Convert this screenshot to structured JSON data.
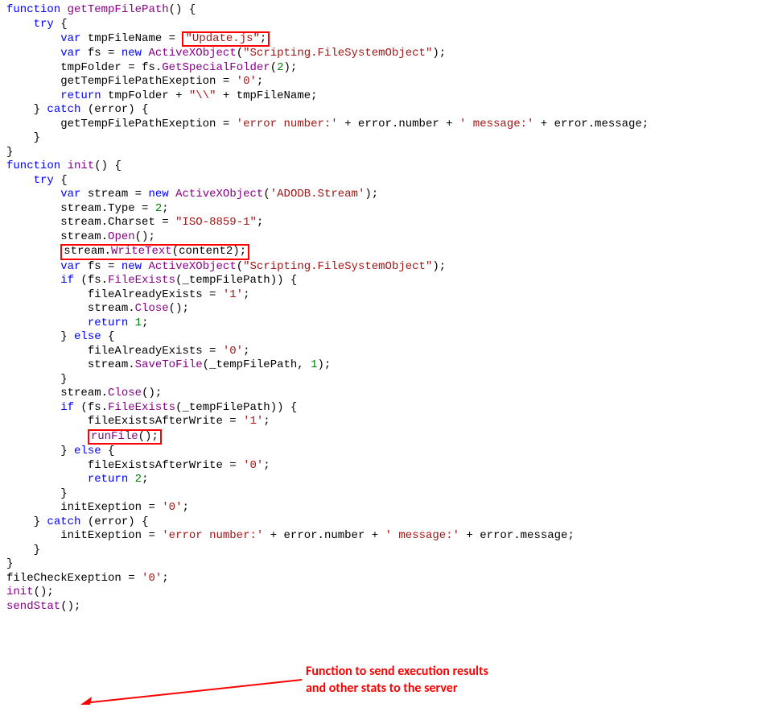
{
  "code": {
    "fn1_decl_function": "function",
    "fn1_name": "getTempFilePath",
    "try_kw": "try",
    "var_kw": "var",
    "new_kw": "new",
    "return_kw": "return",
    "catch_kw": "catch",
    "if_kw": "if",
    "else_kw": "else",
    "tmpFileName_ident": "tmpFileName",
    "update_js_str": "\"Update.js\"",
    "fs_ident": "fs",
    "ActiveXObject": "ActiveXObject",
    "fso_str": "\"Scripting.FileSystemObject\"",
    "tmpFolder_ident": "tmpFolder",
    "GetSpecialFolder": "GetSpecialFolder",
    "two": "2",
    "getTempFilePathExeption_ident": "getTempFilePathExeption",
    "zero_str": "'0'",
    "backslash_str": "\"\\\\\"",
    "error_ident": "error",
    "err_num_str": "'error number:'",
    "number_prop": "number",
    "msg_str": "' message:'",
    "message_prop": "message",
    "fn2_name": "init",
    "stream_ident": "stream",
    "adodb_str": "'ADODB.Stream'",
    "Type_prop": "Type",
    "Charset_prop": "Charset",
    "iso_str": "\"ISO-8859-1\"",
    "Open_call": "Open",
    "WriteText_call": "WriteText",
    "content2_ident": "content2",
    "FileExists_call": "FileExists",
    "tempFilePath_ident": "_tempFilePath",
    "fileAlreadyExists_ident": "fileAlreadyExists",
    "one_str": "'1'",
    "Close_call": "Close",
    "one_num": "1",
    "SaveToFile_call": "SaveToFile",
    "fileExistsAfterWrite_ident": "fileExistsAfterWrite",
    "runFile_call": "runFile",
    "two_num": "2",
    "initExeption_ident": "initExeption",
    "fileCheckExeption_ident": "fileCheckExeption",
    "init_call": "init",
    "sendStat_call": "sendStat"
  },
  "annotation": {
    "line1": "Function to send execution results",
    "line2": "and other stats to the server"
  }
}
